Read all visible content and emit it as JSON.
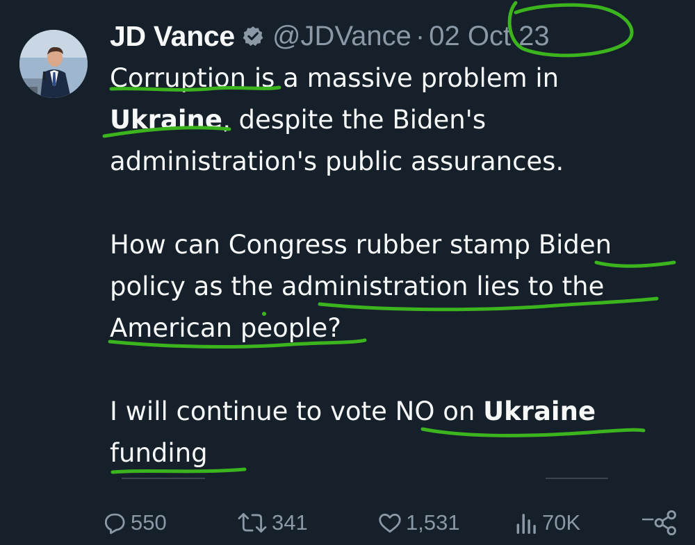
{
  "tweet": {
    "display_name": "JD Vance",
    "handle": "@JDVance",
    "separator": "·",
    "date": "02 Oct 23",
    "paragraphs": [
      [
        {
          "text": "Corruption is a massive problem in "
        },
        {
          "text": "Ukraine",
          "bold": true
        },
        {
          "text": ", despite the Biden's administration's public assurances."
        }
      ],
      [
        {
          "text": "How can Congress rubber stamp Biden policy as the administration lies to the American people?"
        }
      ],
      [
        {
          "text": "I will continue to vote NO on "
        },
        {
          "text": "Ukraine",
          "bold": true
        },
        {
          "text": " funding"
        }
      ]
    ]
  },
  "metrics": {
    "replies": "550",
    "reposts": "341",
    "likes": "1,531",
    "views": "70K"
  },
  "icons": {
    "verified": "verified-badge-icon",
    "reply": "reply-icon",
    "repost": "repost-icon",
    "like": "heart-icon",
    "views": "views-bar-chart-icon",
    "share": "share-icon"
  },
  "colors": {
    "background": "#15202b",
    "text": "#f7f9f9",
    "secondary_text": "#8b98a5",
    "annotation_marker": "#3cb41e"
  }
}
